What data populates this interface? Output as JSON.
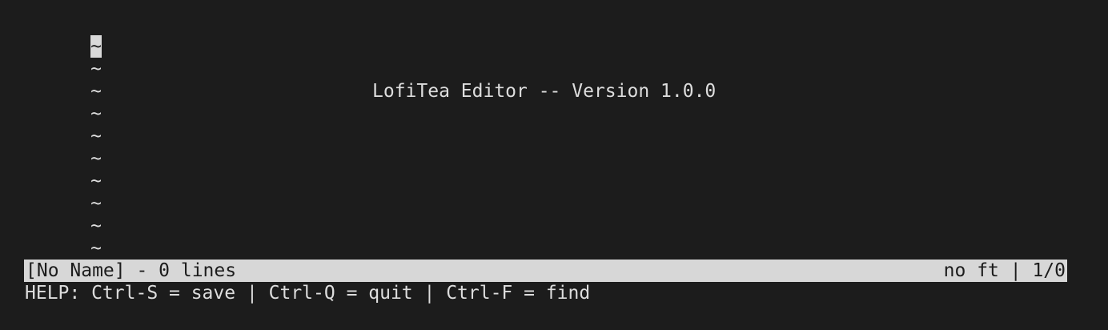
{
  "editor": {
    "tilde_glyph": "~",
    "welcome_message": "LofiTea Editor -- Version 1.0.0"
  },
  "status_bar": {
    "left_text": "[No Name] - 0 lines",
    "right_text": "no ft | 1/0"
  },
  "help_line": {
    "text": "HELP: Ctrl-S = save | Ctrl-Q = quit | Ctrl-F = find"
  },
  "colors": {
    "background": "#1c1c1c",
    "foreground": "#dddddd",
    "status_bar_background": "#d7d7d7",
    "status_bar_foreground": "#1c1c1c",
    "cursor": "#d9d9d9"
  }
}
